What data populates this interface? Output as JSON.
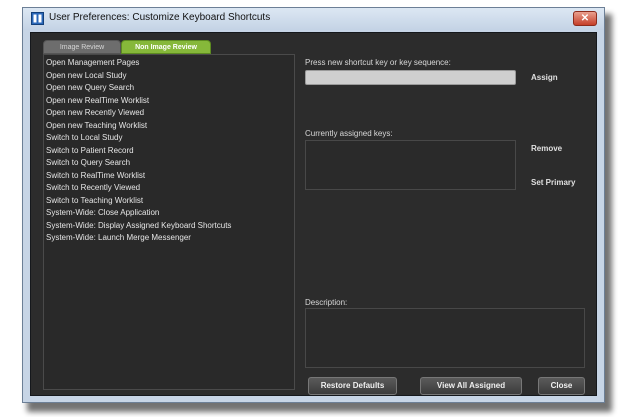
{
  "window": {
    "title": "User Preferences: Customize Keyboard Shortcuts",
    "close_label": "✕"
  },
  "tabs": [
    "Image Review",
    "Non Image Review"
  ],
  "shortcuts": [
    "Open Management Pages",
    "Open new Local Study",
    "Open new Query Search",
    "Open new RealTime Worklist",
    "Open new Recently Viewed",
    "Open new Teaching Worklist",
    "Switch to Local Study",
    "Switch to Patient Record",
    "Switch to Query Search",
    "Switch to RealTime Worklist",
    "Switch to Recently Viewed",
    "Switch to Teaching Worklist",
    "System-Wide: Close Application",
    "System-Wide: Display Assigned Keyboard Shortcuts",
    "System-Wide: Launch Merge Messenger"
  ],
  "shortcut_input": {
    "label": "Press new shortcut key or key sequence:",
    "value": "",
    "assign_label": "Assign"
  },
  "assigned": {
    "label": "Currently assigned keys:",
    "remove_label": "Remove",
    "set_primary_label": "Set Primary"
  },
  "description": {
    "label": "Description:"
  },
  "buttons": {
    "restore": "Restore Defaults",
    "view_all": "View All Assigned",
    "close": "Close"
  },
  "colors": {
    "active_tab": "#86b83a",
    "background": "#2c2c2c"
  }
}
